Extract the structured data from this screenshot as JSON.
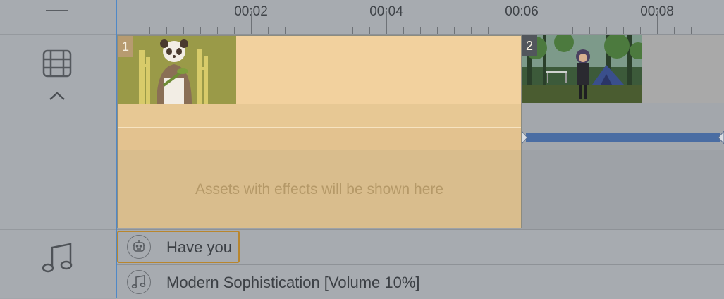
{
  "ruler": {
    "labels": [
      "00:02",
      "00:04",
      "00:06",
      "00:08"
    ]
  },
  "sidebar": {
    "menu_icon": "hamburger-icon",
    "video_icon": "film-grid-icon",
    "collapse_icon": "chevron-up-icon",
    "audio_icon": "music-note-icon"
  },
  "scenes": [
    {
      "number": "1",
      "thumbnail": "panda-with-bamboo"
    },
    {
      "number": "2",
      "thumbnail": "camping-forest"
    }
  ],
  "effects_placeholder": "Assets with effects will be shown here",
  "audio": {
    "voice_clip_label": "Have you",
    "voice_clip_icon": "robot-icon",
    "music_clip_label": "Modern Sophistication [Volume 10%]",
    "music_clip_icon": "music-note-icon"
  },
  "colors": {
    "playhead": "#4f88c7",
    "scene_selected": "#f2d19e",
    "transition_bar": "#4a6da3",
    "voice_clip_border": "#b8862e"
  }
}
